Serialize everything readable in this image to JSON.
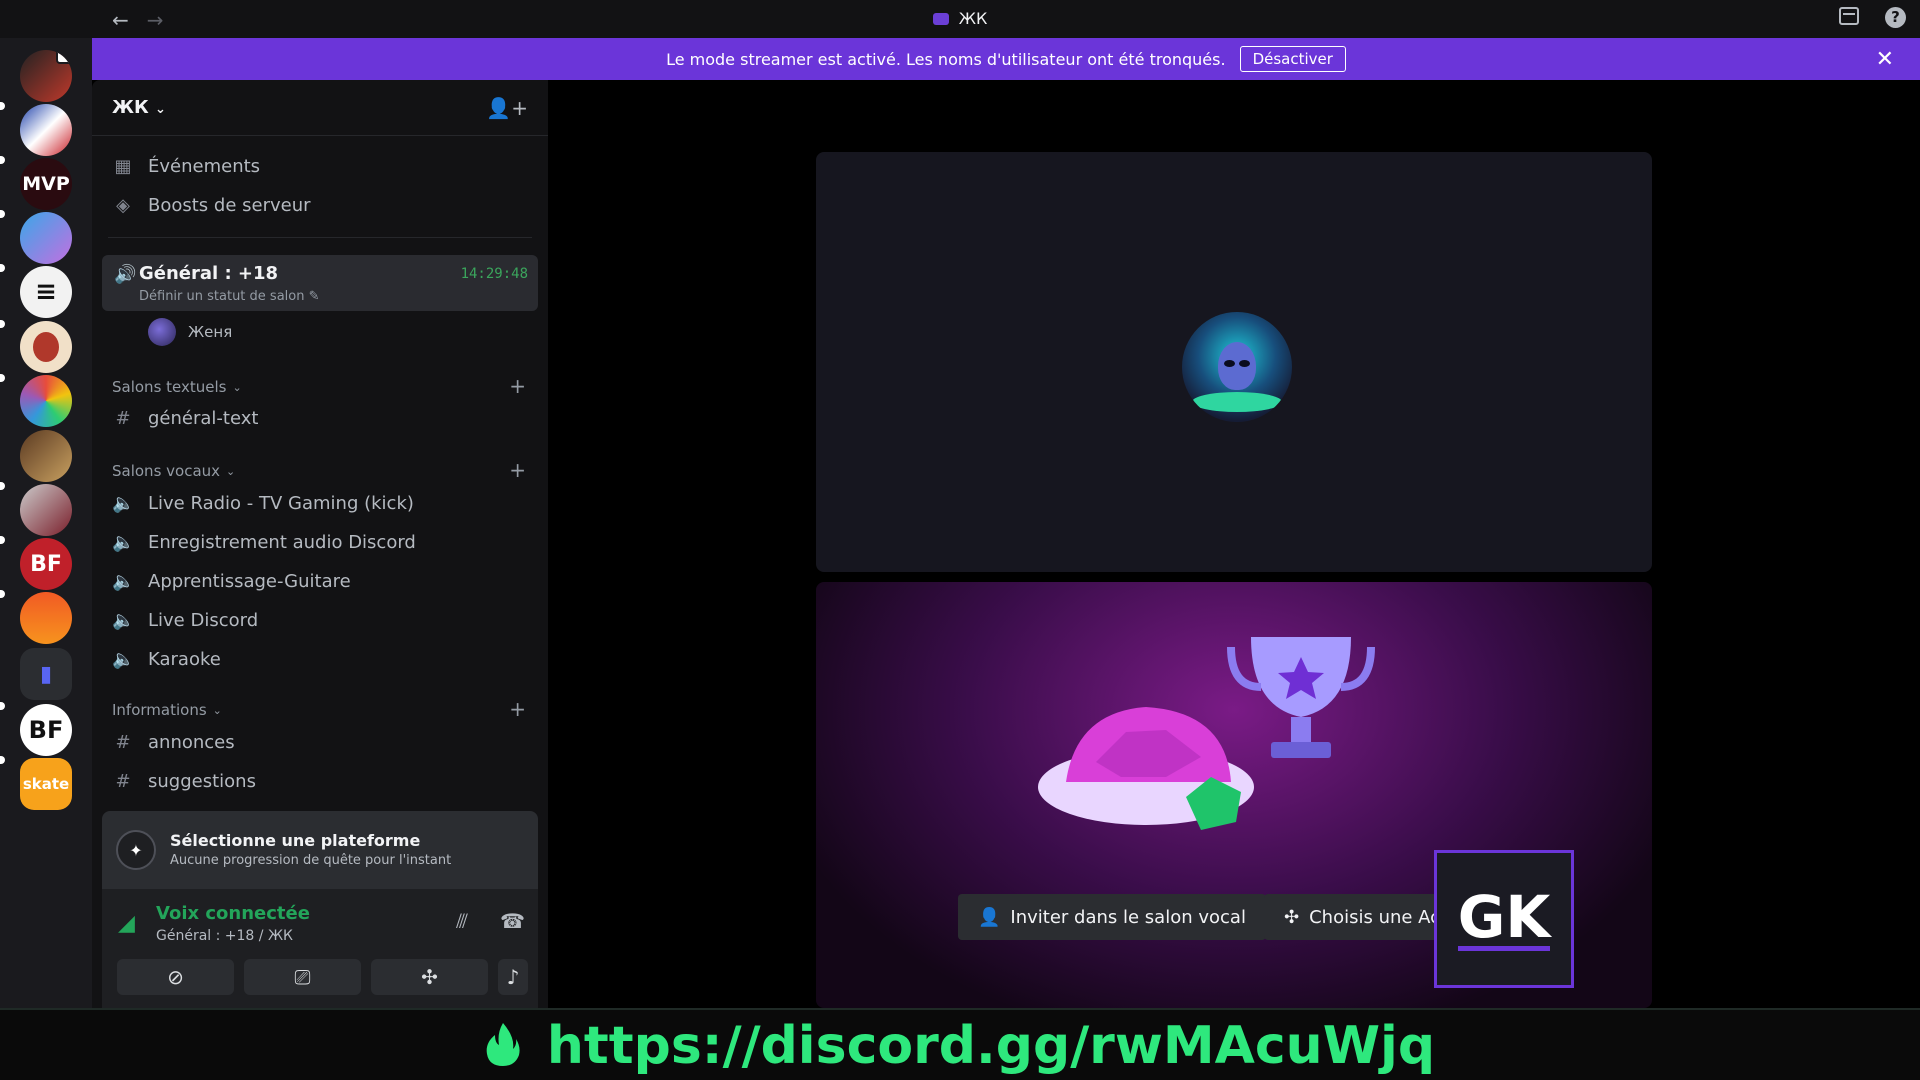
{
  "window": {
    "title": "ЖК"
  },
  "banner": {
    "message": "Le mode streamer est activé. Les noms d'utilisateur ont été tronqués.",
    "button": "Désactiver"
  },
  "guilds": [
    {
      "label": ""
    },
    {
      "label": ""
    },
    {
      "label": "MVP"
    },
    {
      "label": ""
    },
    {
      "label": ""
    },
    {
      "label": ""
    },
    {
      "label": ""
    },
    {
      "label": ""
    },
    {
      "label": ""
    },
    {
      "label": "BF"
    },
    {
      "label": ""
    },
    {
      "label": ""
    },
    {
      "label": "BF"
    },
    {
      "label": "skate"
    }
  ],
  "server": {
    "name": "ЖК"
  },
  "menu": {
    "events": "Événements",
    "boosts": "Boosts de serveur"
  },
  "voice_channel": {
    "name": "Général : +18",
    "status": "Définir un statut de salon",
    "timer": "14:29:48",
    "member": "Женя"
  },
  "categories": {
    "text": "Salons textuels",
    "voice": "Salons vocaux",
    "info": "Informations"
  },
  "text_channels": [
    "général-text"
  ],
  "voice_channels": [
    "Live Radio - TV Gaming (kick)",
    "Enregistrement audio Discord",
    "Apprentissage-Guitare",
    "Live Discord",
    "Karaoke"
  ],
  "info_channels": [
    "annonces",
    "suggestions"
  ],
  "quest": {
    "title": "Sélectionne une plateforme",
    "subtitle": "Aucune progression de quête pour l'instant"
  },
  "voice_status": {
    "title": "Voix connectée",
    "subtitle": "Général : +18 / ЖК"
  },
  "stage": {
    "invite_button": "Inviter dans le salon vocal",
    "activity_button": "Choisis une Activité",
    "overlay_logo": "GK"
  },
  "footer": {
    "link": "https://discord.gg/rwMAcuWjq"
  }
}
